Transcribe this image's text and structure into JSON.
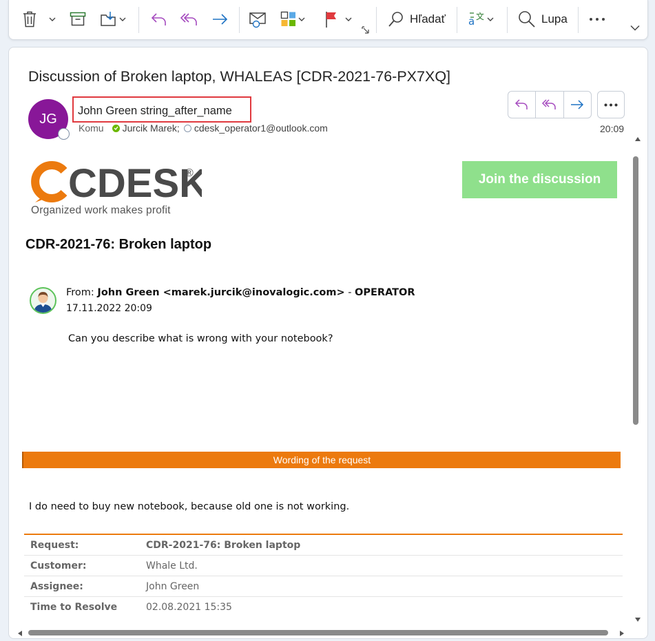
{
  "toolbar": {
    "search_label": "Hľadať",
    "zoom_label": "Lupa"
  },
  "message": {
    "subject": "Discussion of Broken laptop, WHALEAS [CDR-2021-76-PX7XQ]",
    "avatar_initials": "JG",
    "avatar_color": "#881798",
    "sender": "John Green string_after_name",
    "to_label": "Komu",
    "recipients": [
      "Jurcik Marek;",
      "cdesk_operator1@outlook.com"
    ],
    "time": "20:09"
  },
  "body": {
    "logo_text": "CDESK",
    "logo_reg": "®",
    "logo_tagline": "Organized work makes profit",
    "join_button": "Join the discussion",
    "ticket_title": "CDR-2021-76: Broken laptop",
    "from_label": "From:",
    "from_name": "John Green <marek.jurcik@inovalogic.com>",
    "from_sep": " - ",
    "from_role": "OPERATOR",
    "msg_date": "17.11.2022 20:09",
    "msg_text": "Can you describe what is wrong with your notebook?",
    "section_title": "Wording of the request",
    "request_text": "I do need to buy new notebook, because old one is not working.",
    "info": [
      {
        "key": "Request:",
        "value": "CDR-2021-76: Broken laptop"
      },
      {
        "key": "Customer:",
        "value": "Whale Ltd."
      },
      {
        "key": "Assignee:",
        "value": "John Green"
      },
      {
        "key": "Time to Resolve",
        "value": "02.08.2021 15:35"
      }
    ],
    "brand_orange": "#ec7a0e",
    "join_green": "#8fe08c"
  }
}
